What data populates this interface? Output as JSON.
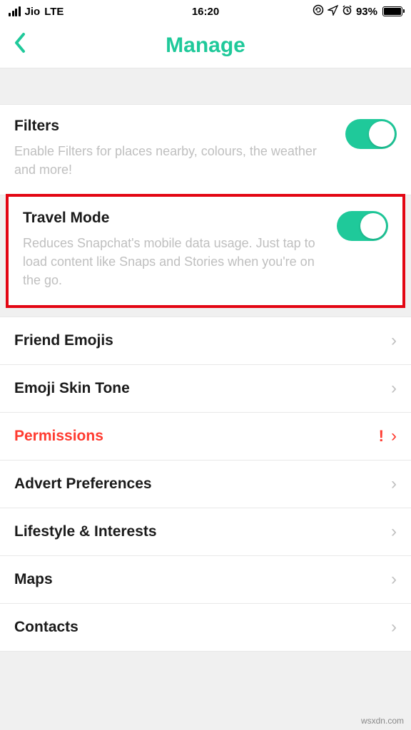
{
  "status": {
    "carrier": "Jio",
    "network": "LTE",
    "time": "16:20",
    "battery": "93%"
  },
  "nav": {
    "title": "Manage"
  },
  "filters": {
    "title": "Filters",
    "desc": "Enable Filters for places nearby, colours, the weather and more!"
  },
  "travel": {
    "title": "Travel Mode",
    "desc": "Reduces Snapchat's mobile data usage. Just tap to load content like Snaps and Stories when you're on the go."
  },
  "rows": {
    "friend_emojis": "Friend Emojis",
    "emoji_skin": "Emoji Skin Tone",
    "permissions": "Permissions",
    "advert": "Advert Preferences",
    "lifestyle": "Lifestyle & Interests",
    "maps": "Maps",
    "contacts": "Contacts"
  },
  "footer": "wsxdn.com"
}
